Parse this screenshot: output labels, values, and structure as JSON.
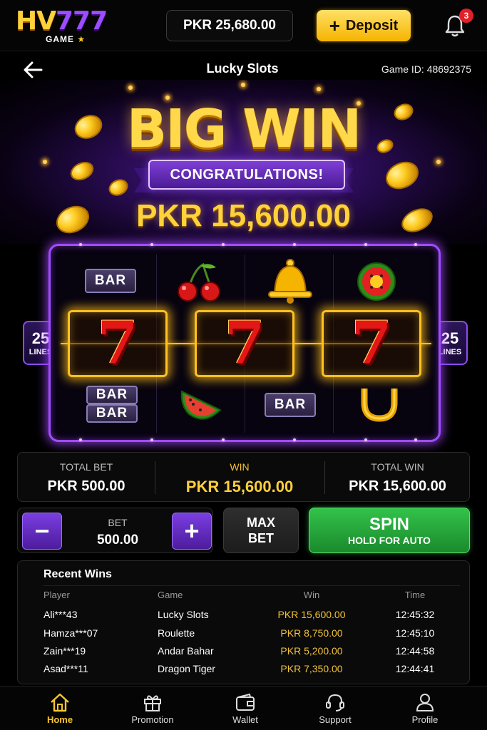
{
  "header": {
    "logo_text": "HV777",
    "logo_sub": "GAME",
    "balance": "PKR 25,680.00",
    "deposit_label": "Deposit",
    "notification_count": "3"
  },
  "subheader": {
    "title": "Lucky Slots",
    "game_id": "Game ID: 48692375"
  },
  "banner": {
    "headline": "BIG WIN",
    "ribbon": "CONGRATULATIONS!",
    "amount": "PKR 15,600.00"
  },
  "reels": {
    "lines_count": "25",
    "lines_label": "LINES",
    "bar_label": "BAR",
    "seven_label": "7",
    "top_row": [
      "bar",
      "cherry",
      "bell",
      "watermelon"
    ],
    "middle_row": [
      "seven",
      "seven",
      "seven"
    ],
    "bottom_row": [
      "double-bar",
      "watermelon-slice",
      "bar",
      "horseshoe"
    ]
  },
  "stats": {
    "total_bet_label": "TOTAL BET",
    "total_bet_value": "PKR 500.00",
    "win_label": "WIN",
    "win_value": "PKR 15,600.00",
    "total_win_label": "TOTAL WIN",
    "total_win_value": "PKR 15,600.00"
  },
  "controls": {
    "minus": "−",
    "plus": "+",
    "bet_label": "BET",
    "bet_value": "500.00",
    "max_bet_line1": "MAX",
    "max_bet_line2": "BET",
    "spin_label": "SPIN",
    "spin_sub": "HOLD FOR AUTO"
  },
  "recent_wins": {
    "title": "Recent Wins",
    "columns": {
      "player": "Player",
      "game": "Game",
      "win": "Win",
      "time": "Time"
    },
    "rows": [
      {
        "player": "Ali***43",
        "game": "Lucky Slots",
        "win": "PKR 15,600.00",
        "time": "12:45:32"
      },
      {
        "player": "Hamza***07",
        "game": "Roulette",
        "win": "PKR 8,750.00",
        "time": "12:45:10"
      },
      {
        "player": "Zain***19",
        "game": "Andar Bahar",
        "win": "PKR 5,200.00",
        "time": "12:44:58"
      },
      {
        "player": "Asad***11",
        "game": "Dragon Tiger",
        "win": "PKR 7,350.00",
        "time": "12:44:41"
      }
    ]
  },
  "nav": {
    "items": [
      {
        "label": "Home",
        "icon": "home-icon",
        "active": true
      },
      {
        "label": "Promotion",
        "icon": "gift-icon",
        "active": false
      },
      {
        "label": "Wallet",
        "icon": "wallet-icon",
        "active": false
      },
      {
        "label": "Support",
        "icon": "headset-icon",
        "active": false
      },
      {
        "label": "Profile",
        "icon": "user-icon",
        "active": false
      }
    ]
  },
  "colors": {
    "gold": "#ffd23a",
    "purple": "#a24cff",
    "spin_green": "#2aa83d"
  }
}
